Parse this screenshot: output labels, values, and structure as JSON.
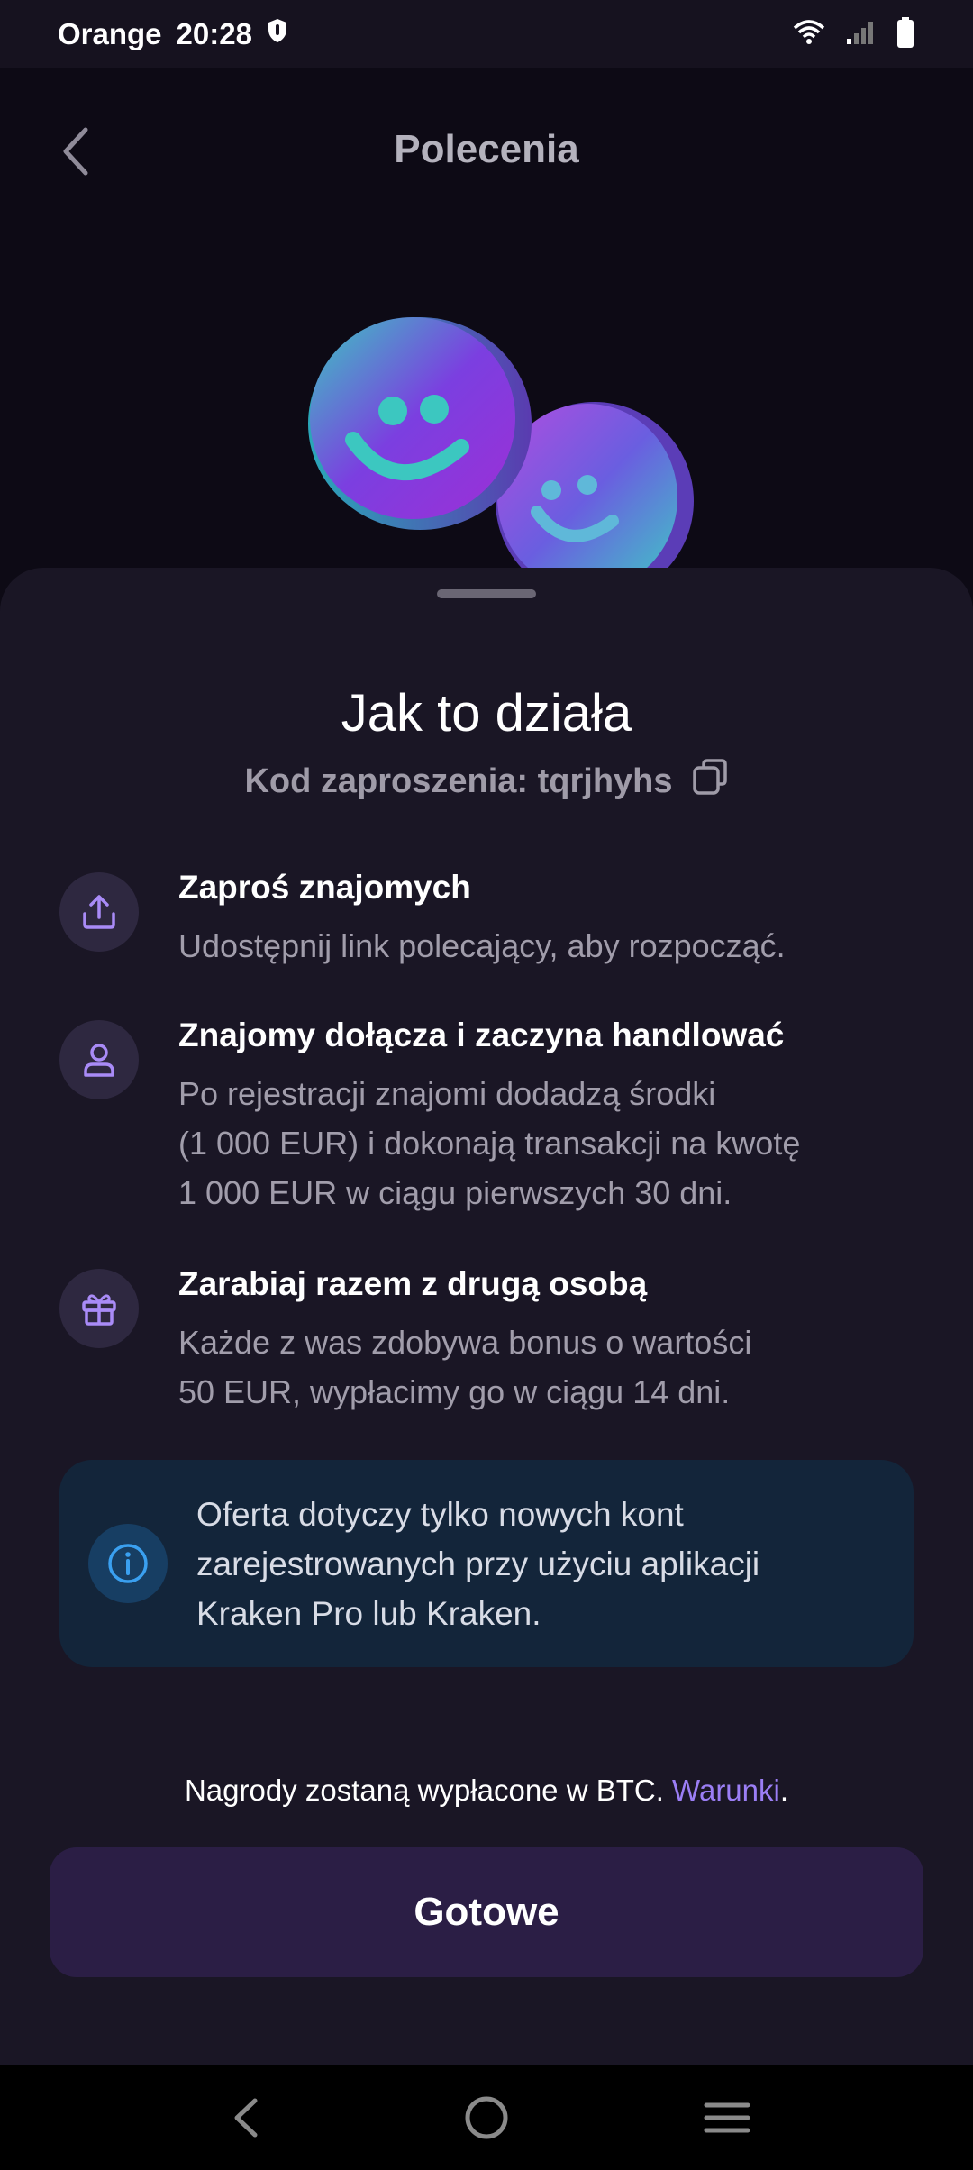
{
  "status_bar": {
    "carrier": "Orange",
    "time": "20:28",
    "icons": [
      "shield-icon",
      "wifi-icon",
      "signal-icon",
      "battery-icon"
    ]
  },
  "header": {
    "title": "Polecenia",
    "back_icon": "back-chevron-icon"
  },
  "hero": {
    "image": "smiley-coins-illustration"
  },
  "sheet": {
    "title": "Jak to działa",
    "invite_code": "Kod zaproszenia: tqrjhyhs",
    "copy_icon": "copy-icon",
    "steps": [
      {
        "icon": "share-icon",
        "title": "Zaproś znajomych",
        "lines": [
          "Udostępnij link polecający, aby rozpocząć."
        ]
      },
      {
        "icon": "person-icon",
        "title": "Znajomy dołącza i zaczyna handlować",
        "lines": [
          "Po rejestracji znajomi dodadzą środki",
          "(1 000 EUR) i dokonają transakcji na kwotę",
          "1 000 EUR w ciągu pierwszych 30 dni."
        ]
      },
      {
        "icon": "gift-icon",
        "title": "Zarabiaj razem z drugą osobą",
        "lines": [
          "Każde z was zdobywa bonus o wartości",
          "50 EUR, wypłacimy go w ciągu 14 dni."
        ]
      }
    ],
    "info": {
      "icon": "info-icon",
      "lines": [
        "Oferta dotyczy tylko nowych kont",
        "zarejestrowanych przy użyciu aplikacji",
        "Kraken Pro lub Kraken."
      ]
    },
    "rewards_text": "Nagrody zostaną wypłacone w BTC.",
    "rewards_link": "Warunki",
    "rewards_period": ".",
    "done_label": "Gotowe"
  },
  "nav_bar": {
    "icons": [
      "nav-back-icon",
      "nav-home-icon",
      "nav-recents-icon"
    ]
  },
  "colors": {
    "background": "#0d0a15",
    "sheet": "#1a1625",
    "accent_link": "#9b7ef5",
    "icon_purple": "#a98bf7",
    "info_blue": "#3aa0f0",
    "button": "#2b1e45"
  }
}
